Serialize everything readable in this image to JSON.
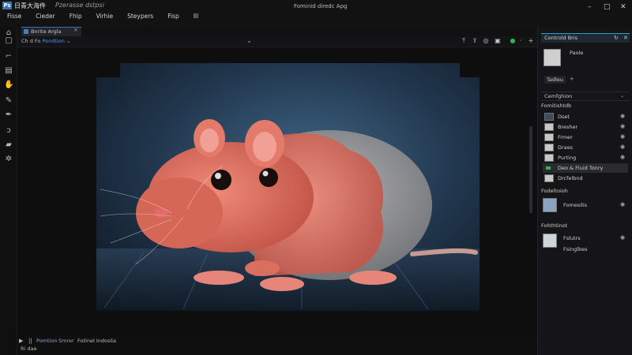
{
  "app": {
    "logo_glyph": "Ps",
    "name": "日青大海件",
    "subtitle": "Pzerasse dstpsi",
    "window_title": "Fominid diredc Apg"
  },
  "window_controls": {
    "minimize": "–",
    "maximize": "□",
    "close": "✕"
  },
  "menu": [
    {
      "label": "Fisse"
    },
    {
      "label": "Cieder"
    },
    {
      "label": "Fhip"
    },
    {
      "label": "Virhie"
    },
    {
      "label": "Steypers"
    },
    {
      "label": "Fisp"
    },
    {
      "label": "Ill"
    }
  ],
  "document_tab": {
    "label": "Bnrite Argla",
    "close": "×"
  },
  "options_bar": {
    "tool_label": "Ch d Fo",
    "mode_label": "Pendtion",
    "dropdown_glyph": "⌄",
    "center_glyph": "⌄"
  },
  "status_bar": {
    "play_icon": "▶",
    "pause_icon": "||",
    "item1": "Pomtion",
    "item2": "Smrer",
    "item3": "Fotinel Indoslia",
    "zoom": "Ri dae"
  },
  "right_panel": {
    "header_label": "Controld Bris",
    "thumb_label": "Paole",
    "button_label": "Tadleu",
    "plus": "+",
    "section_label": "Cemfghion",
    "groups": [
      {
        "label": "Fomitishtdb"
      },
      {
        "label": "Fodeltoioh"
      },
      {
        "label": "Fohthtinot"
      }
    ],
    "layers": [
      {
        "name": "Dset"
      },
      {
        "name": "Bresher"
      },
      {
        "name": "Frmer"
      },
      {
        "name": "Draes"
      },
      {
        "name": "Purting"
      },
      {
        "name": "Deo & Fluid Tonry"
      },
      {
        "name": "Drcfelbnd"
      },
      {
        "name": "Fomesilis"
      },
      {
        "name": "Fslutrs"
      },
      {
        "name": "Fsinglbes"
      }
    ]
  },
  "colors": {
    "accent": "#3d6fb5",
    "panel_accent": "#2aa0c8",
    "mask_overlay": "#ff3b30",
    "green": "#36b24c"
  }
}
